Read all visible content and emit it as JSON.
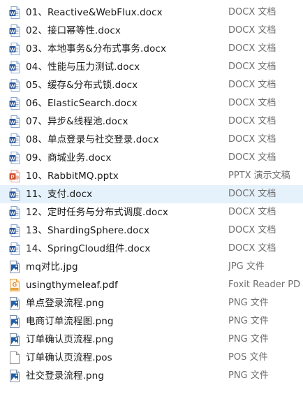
{
  "files": [
    {
      "name": "01、Reactive&WebFlux.docx",
      "type": "DOCX 文档",
      "icon": "docx-icon",
      "selected": false
    },
    {
      "name": "02、接口幂等性.docx",
      "type": "DOCX 文档",
      "icon": "docx-icon",
      "selected": false
    },
    {
      "name": "03、本地事务&分布式事务.docx",
      "type": "DOCX 文档",
      "icon": "docx-icon",
      "selected": false
    },
    {
      "name": "04、性能与压力测试.docx",
      "type": "DOCX 文档",
      "icon": "docx-icon",
      "selected": false
    },
    {
      "name": "05、缓存&分布式锁.docx",
      "type": "DOCX 文档",
      "icon": "docx-icon",
      "selected": false
    },
    {
      "name": "06、ElasticSearch.docx",
      "type": "DOCX 文档",
      "icon": "docx-icon",
      "selected": false
    },
    {
      "name": "07、异步&线程池.docx",
      "type": "DOCX 文档",
      "icon": "docx-icon",
      "selected": false
    },
    {
      "name": "08、单点登录与社交登录.docx",
      "type": "DOCX 文档",
      "icon": "docx-icon",
      "selected": false
    },
    {
      "name": "09、商城业务.docx",
      "type": "DOCX 文档",
      "icon": "docx-icon",
      "selected": false
    },
    {
      "name": "10、RabbitMQ.pptx",
      "type": "PPTX 演示文稿",
      "icon": "pptx-icon",
      "selected": false
    },
    {
      "name": "11、支付.docx",
      "type": "DOCX 文档",
      "icon": "docx-icon",
      "selected": true
    },
    {
      "name": "12、定时任务与分布式调度.docx",
      "type": "DOCX 文档",
      "icon": "docx-icon",
      "selected": false
    },
    {
      "name": "13、ShardingSphere.docx",
      "type": "DOCX 文档",
      "icon": "docx-icon",
      "selected": false
    },
    {
      "name": "14、SpringCloud组件.docx",
      "type": "DOCX 文档",
      "icon": "docx-icon",
      "selected": false
    },
    {
      "name": "mq对比.jpg",
      "type": "JPG 文件",
      "icon": "image-file-icon",
      "selected": false
    },
    {
      "name": "usingthymeleaf.pdf",
      "type": "Foxit Reader PD",
      "icon": "pdf-icon",
      "selected": false
    },
    {
      "name": "单点登录流程.png",
      "type": "PNG 文件",
      "icon": "image-file-icon",
      "selected": false
    },
    {
      "name": "电商订单流程图.png",
      "type": "PNG 文件",
      "icon": "image-file-icon",
      "selected": false
    },
    {
      "name": "订单确认页流程.png",
      "type": "PNG 文件",
      "icon": "image-file-icon",
      "selected": false
    },
    {
      "name": "订单确认页流程.pos",
      "type": "POS 文件",
      "icon": "blank-file-icon",
      "selected": false
    },
    {
      "name": "社交登录流程.png",
      "type": "PNG 文件",
      "icon": "image-file-icon",
      "selected": false
    }
  ],
  "colors": {
    "selected_row": "#e5f1fb",
    "docx_blue": "#2b579a",
    "pptx_orange": "#d35230",
    "pdf_orange": "#e8a33d",
    "image_blue": "#1e5fa8",
    "type_text": "#6d6d6d"
  }
}
